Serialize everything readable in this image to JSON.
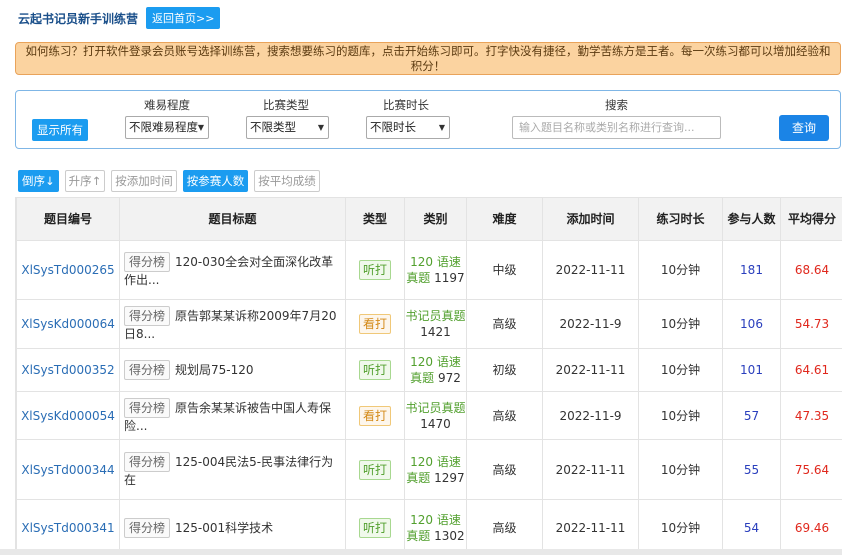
{
  "header": {
    "brand": "云起书记员新手训练营",
    "home_button": "返回首页>>"
  },
  "notice": "如何练习？打开软件登录会员账号选择训练营，搜索想要练习的题库，点击开始练习即可。打字快没有捷径，勤学苦练方是王者。每一次练习都可以增加经验和积分！",
  "filters": {
    "show_all": "显示所有",
    "difficulty": {
      "label": "难易程度",
      "value": "不限难易程度"
    },
    "match_type": {
      "label": "比赛类型",
      "value": "不限类型"
    },
    "duration": {
      "label": "比赛时长",
      "value": "不限时长"
    },
    "search": {
      "label": "搜索",
      "placeholder": "输入题目名称或类别名称进行查询..."
    },
    "query_button": "查询"
  },
  "sort_buttons": [
    {
      "label": "倒序↓",
      "active": true
    },
    {
      "label": "升序↑",
      "active": false
    },
    {
      "label": "按添加时间",
      "active": false
    },
    {
      "label": "按参赛人数",
      "active": true
    },
    {
      "label": "按平均成绩",
      "active": false
    }
  ],
  "table": {
    "headers": [
      "题目编号",
      "题目标题",
      "类型",
      "类别",
      "难度",
      "添加时间",
      "练习时长",
      "参与人数",
      "平均得分"
    ],
    "rank_label": "得分榜",
    "rows": [
      {
        "code": "XlSysTd000265",
        "title": "120-030全会对全面深化改革作出...",
        "type": "听打",
        "kind": "listen",
        "cat_name": "120 语速真题",
        "cat_num": "1197",
        "level": "中级",
        "date": "2022-11-11",
        "duration": "10分钟",
        "count": "181",
        "score": "68.64"
      },
      {
        "code": "XlSysKd000064",
        "title": "原告郭某某诉称2009年7月20日8...",
        "type": "看打",
        "kind": "look",
        "cat_name": "书记员真题",
        "cat_num": "1421",
        "level": "高级",
        "date": "2022-11-9",
        "duration": "10分钟",
        "count": "106",
        "score": "54.73"
      },
      {
        "code": "XlSysTd000352",
        "title": "规划局75-120",
        "type": "听打",
        "kind": "listen",
        "cat_name": "120 语速真题",
        "cat_num": "972",
        "level": "初级",
        "date": "2022-11-11",
        "duration": "10分钟",
        "count": "101",
        "score": "64.61"
      },
      {
        "code": "XlSysKd000054",
        "title": "原告余某某诉被告中国人寿保险...",
        "type": "看打",
        "kind": "look",
        "cat_name": "书记员真题",
        "cat_num": "1470",
        "level": "高级",
        "date": "2022-11-9",
        "duration": "10分钟",
        "count": "57",
        "score": "47.35"
      },
      {
        "code": "XlSysTd000344",
        "title": "125-004民法5-民事法律行为在",
        "type": "听打",
        "kind": "listen",
        "cat_name": "120 语速真题",
        "cat_num": "1297",
        "level": "高级",
        "date": "2022-11-11",
        "duration": "10分钟",
        "count": "55",
        "score": "75.64"
      },
      {
        "code": "XlSysTd000341",
        "title": "125-001科学技术",
        "type": "听打",
        "kind": "listen",
        "cat_name": "120 语速真题",
        "cat_num": "1302",
        "level": "高级",
        "date": "2022-11-11",
        "duration": "10分钟",
        "count": "54",
        "score": "69.46"
      }
    ]
  }
}
